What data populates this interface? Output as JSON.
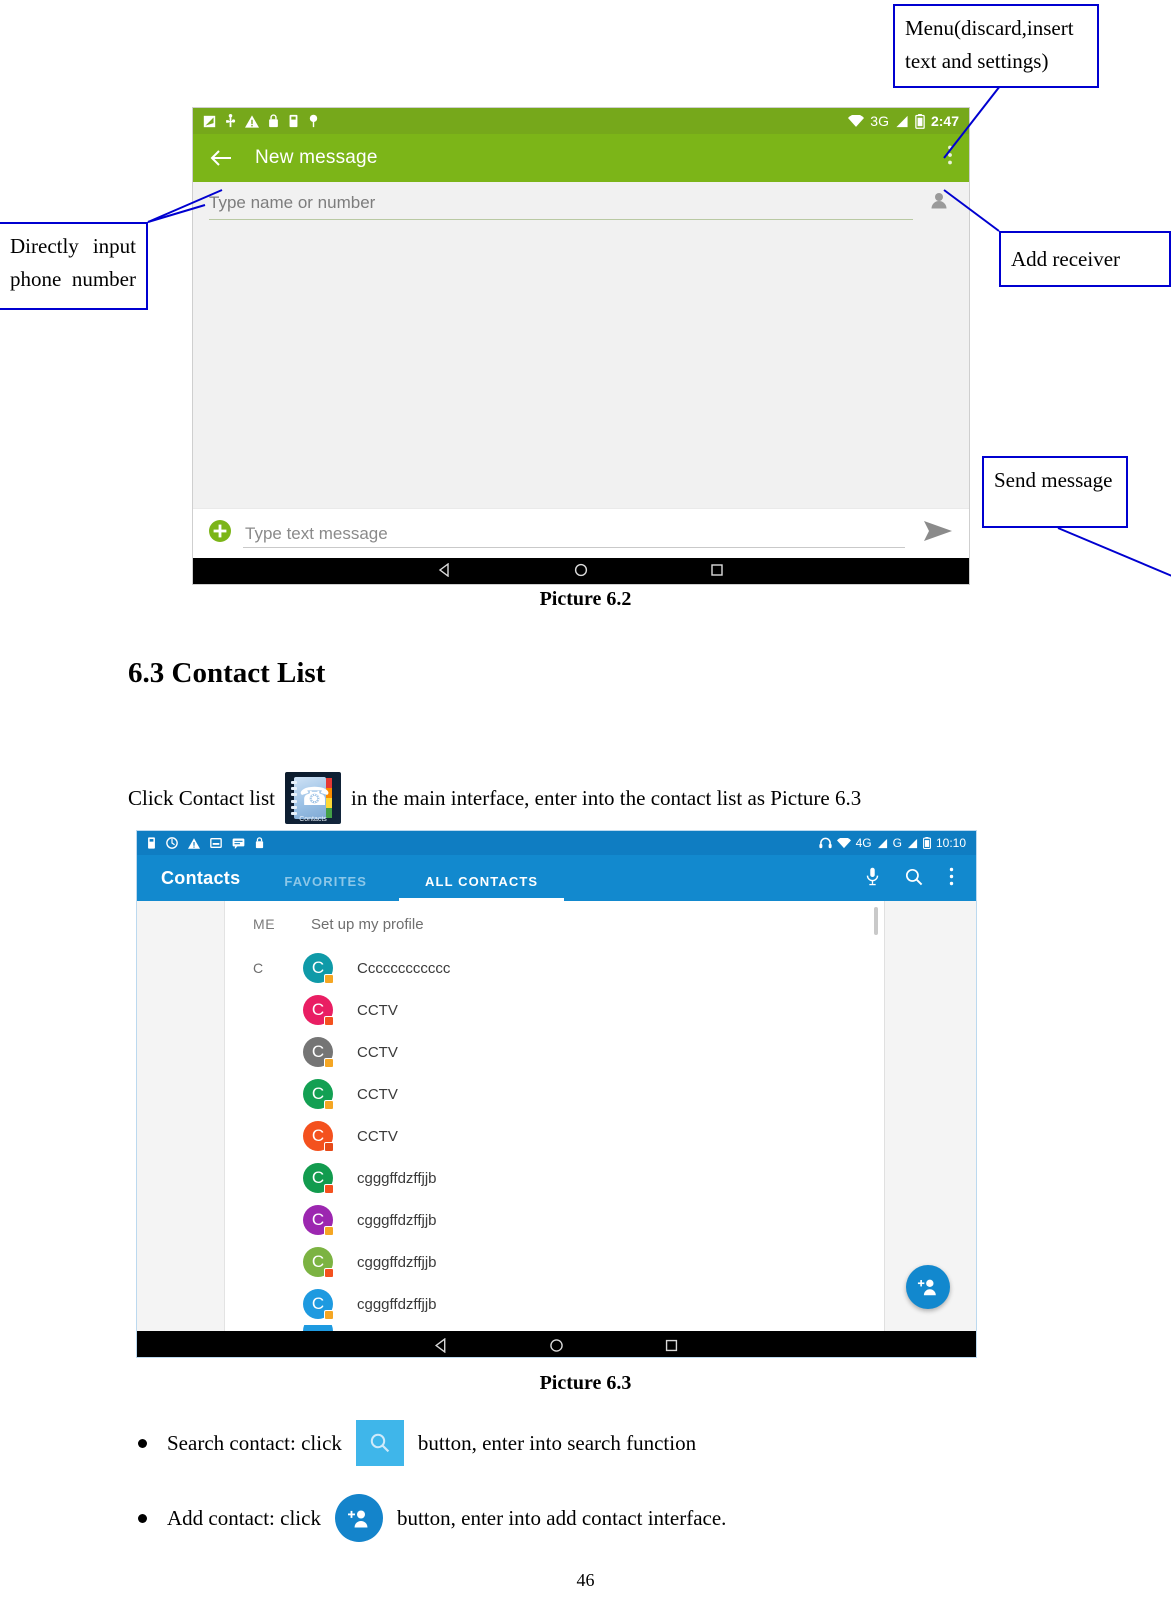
{
  "page": {
    "number": "46"
  },
  "annotations": [
    {
      "name": "menu-callout",
      "text": "Menu(discard,insert text and settings)"
    },
    {
      "name": "phone-number-callout",
      "text": "Directly input phone number"
    },
    {
      "name": "add-receiver-callout",
      "text": "Add receiver"
    },
    {
      "name": "send-message-callout",
      "text": "Send message"
    }
  ],
  "picture62": {
    "caption": "Picture 6.2",
    "statusbar": {
      "icons": [
        "screenshot-icon",
        "usb-icon",
        "warning-icon",
        "lock-icon",
        "sim-icon",
        "location-icon"
      ],
      "wifi": "wifi-icon",
      "network": "3G",
      "signal": "signal-icon",
      "battery": "battery-icon",
      "clock": "2:47"
    },
    "appbar": {
      "back": "back-arrow-icon",
      "title": "New message",
      "menu": "overflow-menu-icon"
    },
    "recipient": {
      "placeholder": "Type name or number",
      "add_icon": "add-person-icon"
    },
    "composer": {
      "attach_icon": "plus-circle-icon",
      "placeholder": "Type text message",
      "send_icon": "send-arrow-icon"
    },
    "navbar": {
      "back": "triangle-back-icon",
      "home": "circle-home-icon",
      "recents": "square-recents-icon"
    }
  },
  "section": {
    "heading": "6.3 Contact List",
    "intro_before": "Click Contact list",
    "intro_icon": "contacts-app-icon",
    "intro_icon_label": "Contacts",
    "intro_after": "in the main interface, enter into the contact list as Picture 6.3"
  },
  "picture63": {
    "caption": "Picture 6.3",
    "statusbar": {
      "icons": [
        "sim-icon",
        "sync-icon",
        "warning-icon",
        "screenshot-icon",
        "message-icon",
        "lock-icon"
      ],
      "headset": "headset-icon",
      "wifi": "wifi-icon",
      "net1": "4G",
      "net2": "G",
      "battery": "battery-icon",
      "clock": "10:10"
    },
    "appbar": {
      "brand": "Contacts",
      "tabs": [
        {
          "label": "FAVORITES",
          "active": false
        },
        {
          "label": "ALL CONTACTS",
          "active": true
        }
      ],
      "actions": [
        "mic-icon",
        "search-icon",
        "overflow-menu-icon"
      ]
    },
    "me": {
      "section": "ME",
      "label": "Set up my profile"
    },
    "section_letter": "C",
    "contacts": [
      {
        "name": "Cccccccccccc",
        "initial": "C",
        "color": "#0f9aa8",
        "badge": "#f5a623"
      },
      {
        "name": "CCTV",
        "initial": "C",
        "color": "#e91e63",
        "badge": "#f4511e"
      },
      {
        "name": "CCTV",
        "initial": "C",
        "color": "#757575",
        "badge": "#f5a623"
      },
      {
        "name": "CCTV",
        "initial": "C",
        "color": "#13a053",
        "badge": "#f5a623"
      },
      {
        "name": "CCTV",
        "initial": "C",
        "color": "#f4511e",
        "badge": "#e64a19"
      },
      {
        "name": "cgggffdzffjjb",
        "initial": "C",
        "color": "#129b4e",
        "badge": "#f4511e"
      },
      {
        "name": "cgggffdzffjjb",
        "initial": "C",
        "color": "#9c27b0",
        "badge": "#f5a623"
      },
      {
        "name": "cgggffdzffjjb",
        "initial": "C",
        "color": "#7cb342",
        "badge": "#f4511e"
      },
      {
        "name": "cgggffdzffjjb",
        "initial": "C",
        "color": "#1e9ae0",
        "badge": "#f5a623"
      }
    ],
    "fab": "add-contact-fab-icon",
    "navbar": {
      "back": "triangle-back-icon",
      "home": "circle-home-icon",
      "recents": "square-recents-icon"
    }
  },
  "bullets": [
    {
      "before": "Search contact: click",
      "icon": "search-button-icon",
      "after": "button, enter into search function"
    },
    {
      "before": "Add contact: click",
      "icon": "add-contact-button-icon",
      "after": "button, enter into add contact interface."
    }
  ]
}
